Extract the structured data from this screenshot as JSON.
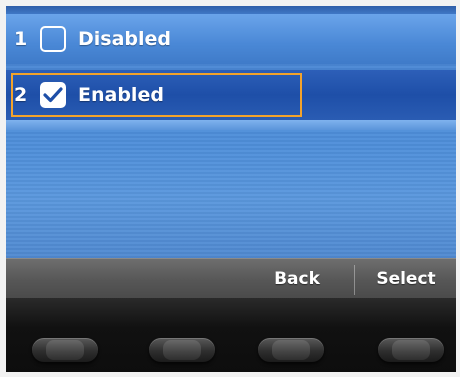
{
  "options": [
    {
      "number": "1",
      "label": "Disabled",
      "checked": false
    },
    {
      "number": "2",
      "label": "Enabled",
      "checked": true
    }
  ],
  "softkeys": {
    "back": "Back",
    "select": "Select"
  },
  "colors": {
    "screen_blue": "#4a86d4",
    "selected_row": "#1e4fa8",
    "highlight_border": "#f3a32c",
    "softkey_bar": "#565656",
    "bezel": "#111111"
  },
  "icons": {
    "checked": "checkmark-icon",
    "unchecked": "empty-checkbox-icon"
  }
}
